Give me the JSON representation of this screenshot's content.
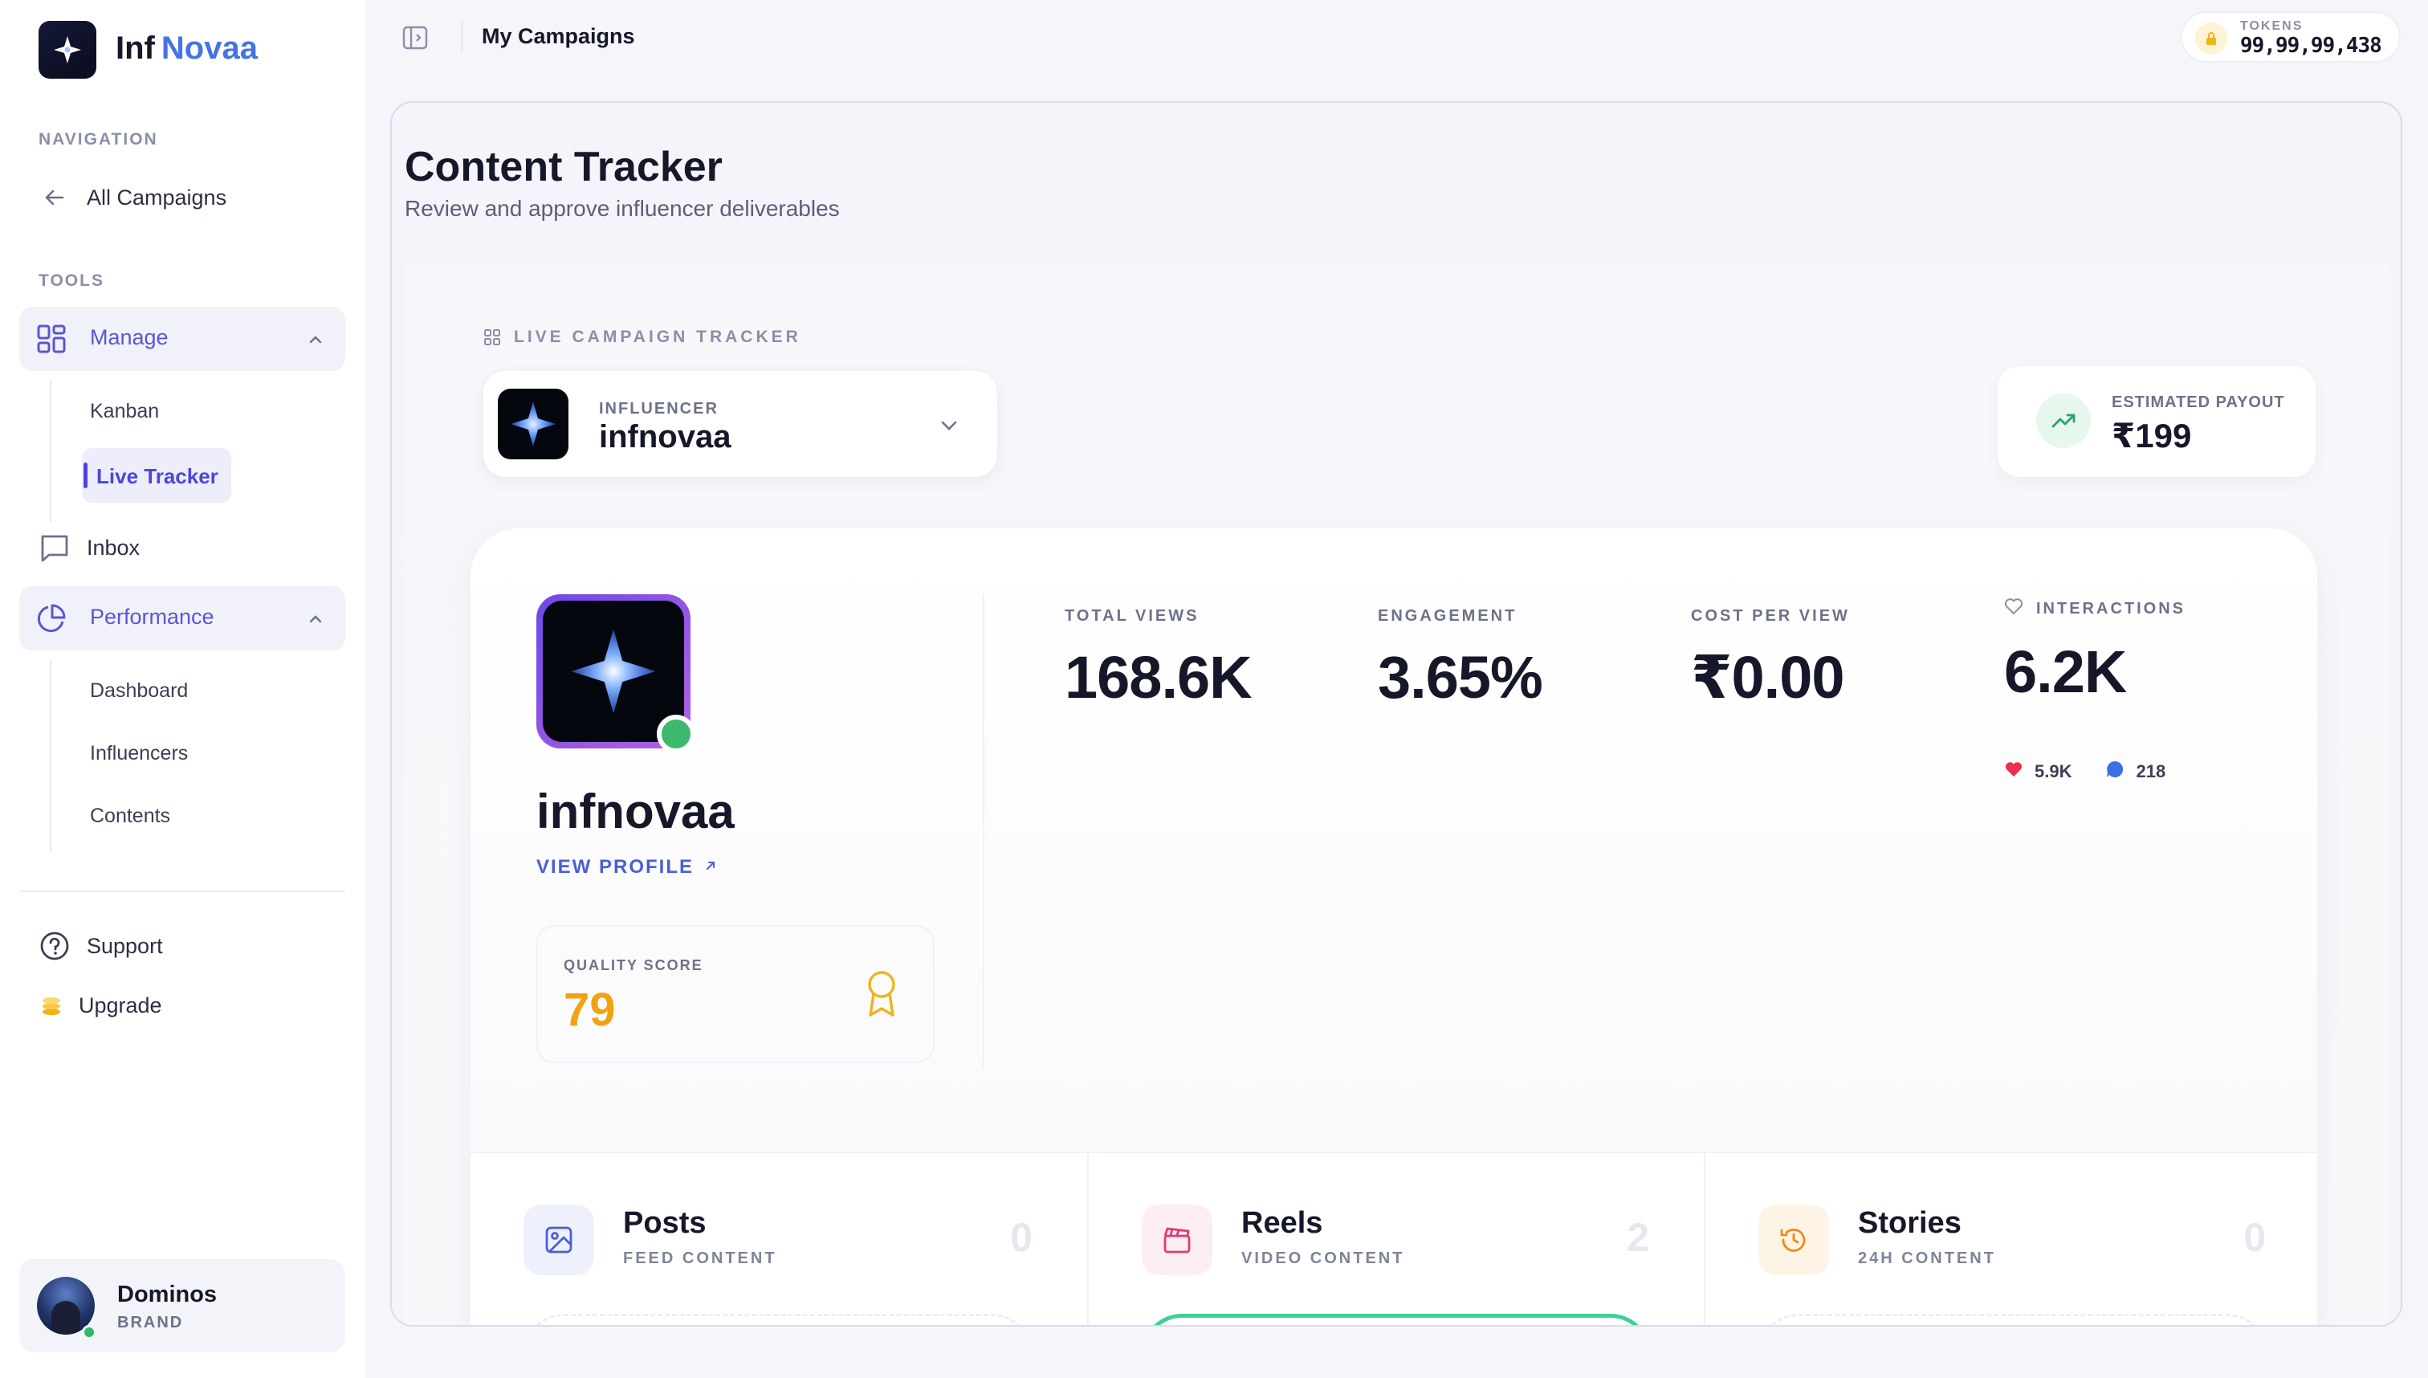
{
  "app": {
    "brand_prefix": "Inf",
    "brand_accent": "Novaa",
    "accent_color": "#4573e6",
    "brand_icon": "star-logo-icon"
  },
  "sidebar": {
    "navigation_title": "NAVIGATION",
    "all_campaigns": "All Campaigns",
    "tools_title": "TOOLS",
    "manage": {
      "label": "Manage",
      "items": [
        "Kanban",
        "Live Tracker"
      ],
      "active_item": "Live Tracker"
    },
    "inbox": "Inbox",
    "performance": {
      "label": "Performance",
      "items": [
        "Dashboard",
        "Influencers",
        "Contents"
      ]
    },
    "support": "Support",
    "upgrade": "Upgrade",
    "user": {
      "name": "Dominos",
      "role": "BRAND",
      "status_color": "#2fba6a"
    }
  },
  "topbar": {
    "title": "My Campaigns",
    "tokens_label": "TOKENS",
    "tokens_value": "99,99,99,438"
  },
  "page": {
    "title": "Content Tracker",
    "subtitle": "Review and approve influencer deliverables",
    "tracker_label": "LIVE CAMPAIGN TRACKER",
    "influencer_label": "INFLUENCER",
    "influencer_name": "infnovaa",
    "payout_label": "ESTIMATED PAYOUT",
    "payout_value": "₹199"
  },
  "profile": {
    "name": "infnovaa",
    "view_profile": "VIEW PROFILE",
    "quality_label": "QUALITY SCORE",
    "quality_value": "79",
    "quality_color": "#f0a312",
    "online_color": "#3db86f"
  },
  "stats": {
    "total_views": {
      "label": "TOTAL VIEWS",
      "value": "168.6K"
    },
    "engagement": {
      "label": "ENGAGEMENT",
      "value": "3.65%"
    },
    "cost_per_view": {
      "label": "COST PER VIEW",
      "value": "₹0.00"
    },
    "interactions": {
      "label": "INTERACTIONS",
      "value": "6.2K",
      "likes": "5.9K",
      "comments": "218"
    }
  },
  "content_types": [
    {
      "title": "Posts",
      "subtitle": "FEED CONTENT",
      "count": "0",
      "icon": "image-icon",
      "color": "#4a5ed8"
    },
    {
      "title": "Reels",
      "subtitle": "VIDEO CONTENT",
      "count": "2",
      "icon": "clapperboard-icon",
      "color": "#e03a75"
    },
    {
      "title": "Stories",
      "subtitle": "24H CONTENT",
      "count": "0",
      "icon": "history-icon",
      "color": "#ee8a1a"
    }
  ]
}
